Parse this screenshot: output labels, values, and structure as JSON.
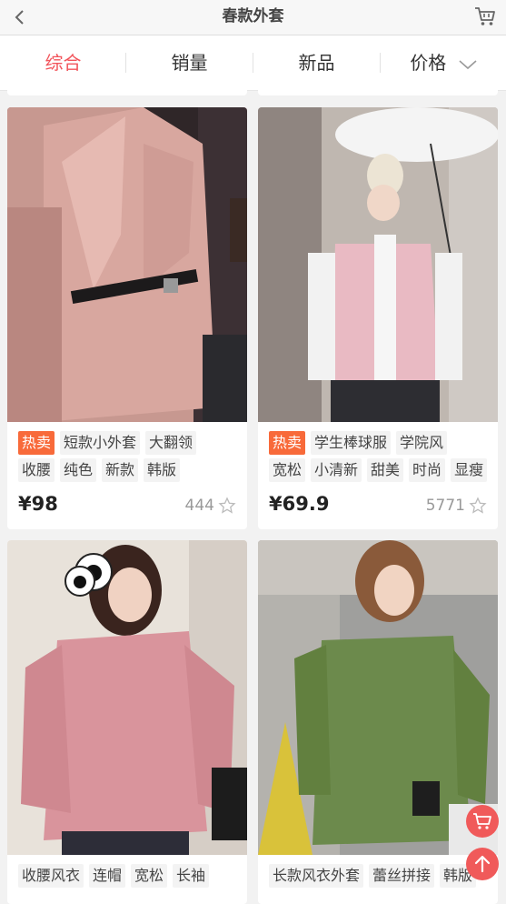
{
  "header": {
    "title": "春款外套"
  },
  "tabs": [
    {
      "label": "综合",
      "active": true
    },
    {
      "label": "销量",
      "active": false
    },
    {
      "label": "新品",
      "active": false
    },
    {
      "label": "价格",
      "active": false
    }
  ],
  "products": [
    {
      "tags_row1": [
        "热卖",
        "短款小外套",
        "大翻领"
      ],
      "tags_row2": [
        "收腰",
        "纯色",
        "新款",
        "韩版"
      ],
      "price": "¥98",
      "sales": "444"
    },
    {
      "tags_row1": [
        "热卖",
        "学生棒球服",
        "学院风"
      ],
      "tags_row2": [
        "宽松",
        "小清新",
        "甜美",
        "时尚",
        "显瘦"
      ],
      "price": "¥69.9",
      "sales": "5771"
    },
    {
      "tags_row1": [
        "收腰风衣",
        "连帽",
        "宽松",
        "长袖"
      ]
    },
    {
      "tags_row1": [
        "长款风衣外套",
        "蕾丝拼接",
        "韩版"
      ]
    }
  ],
  "colors": {
    "accent": "#f2545b",
    "hot_tag": "#f86a3a",
    "fab_red": "#f05a5a"
  }
}
